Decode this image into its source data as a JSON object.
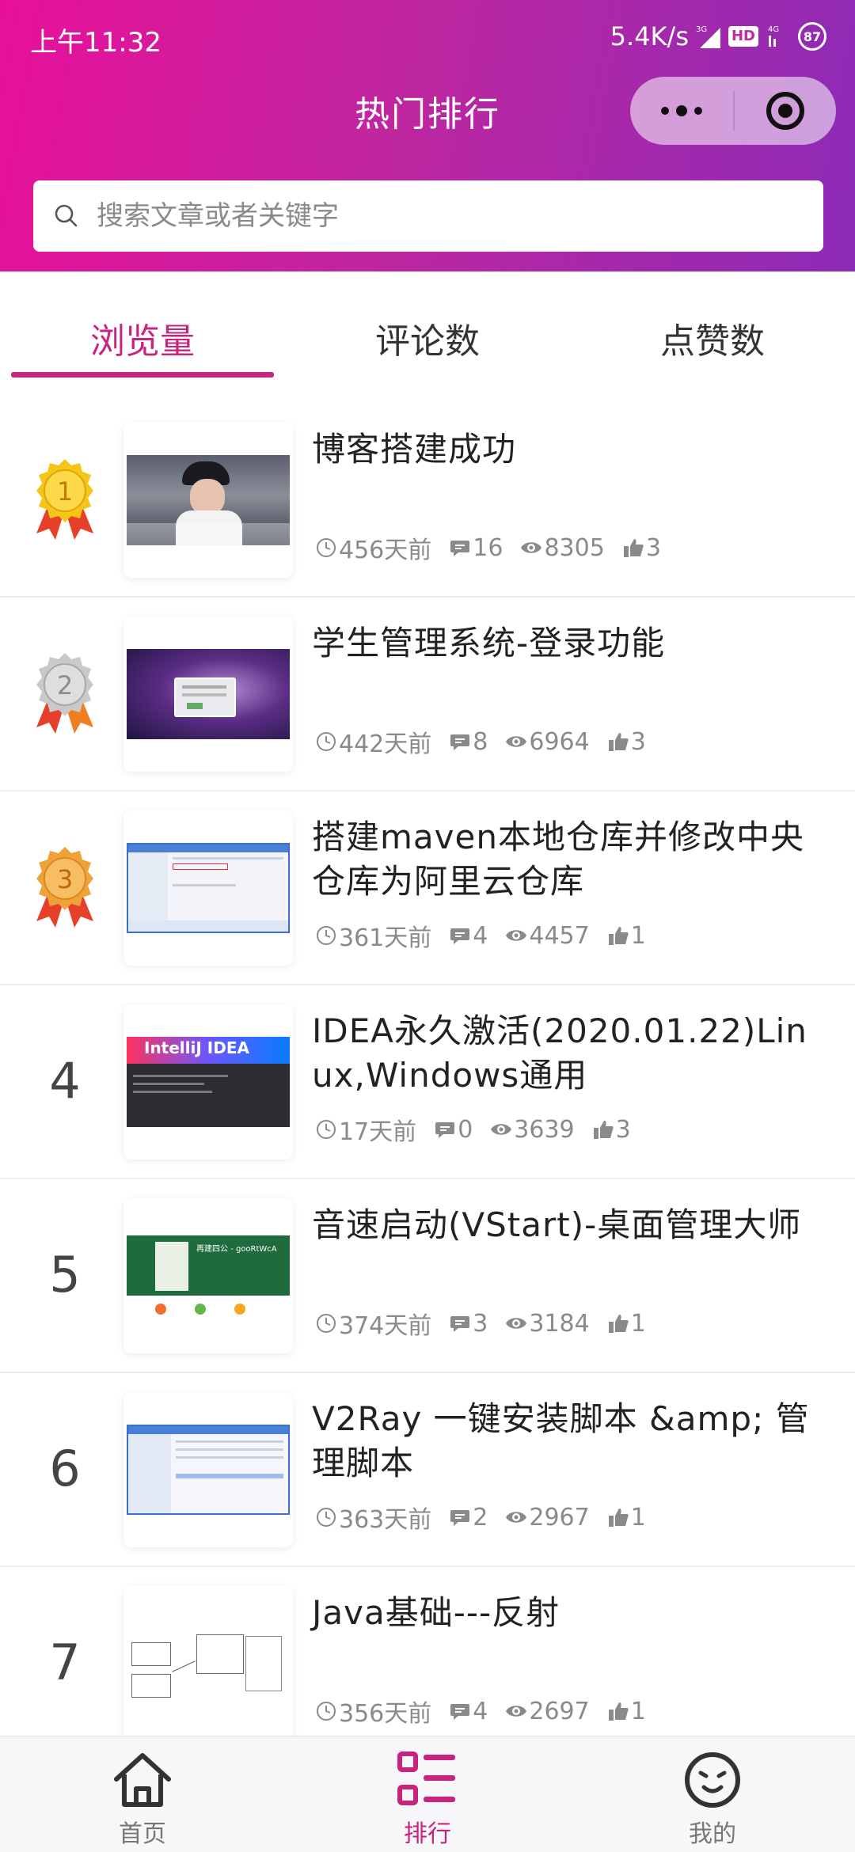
{
  "status": {
    "time": "上午11:32",
    "net_speed": "5.4K/s",
    "signal_label": "3G",
    "hd_label": "HD",
    "net_label": "4G",
    "battery": "87"
  },
  "header": {
    "title": "热门排行",
    "search_placeholder": "搜索文章或者关键字"
  },
  "tabs": [
    {
      "label": "浏览量",
      "active": true
    },
    {
      "label": "评论数",
      "active": false
    },
    {
      "label": "点赞数",
      "active": false
    }
  ],
  "articles": [
    {
      "rank": "1",
      "title": "博客搭建成功",
      "time": "456天前",
      "comments": "16",
      "views": "8305",
      "likes": "3"
    },
    {
      "rank": "2",
      "title": "学生管理系统-登录功能",
      "time": "442天前",
      "comments": "8",
      "views": "6964",
      "likes": "3"
    },
    {
      "rank": "3",
      "title": "搭建maven本地仓库并修改中央仓库为阿里云仓库",
      "time": "361天前",
      "comments": "4",
      "views": "4457",
      "likes": "1"
    },
    {
      "rank": "4",
      "title": "IDEA永久激活(2020.01.22)Linux,Windows通用",
      "time": "17天前",
      "comments": "0",
      "views": "3639",
      "likes": "3"
    },
    {
      "rank": "5",
      "title": "音速启动(VStart)-桌面管理大师",
      "time": "374天前",
      "comments": "3",
      "views": "3184",
      "likes": "1"
    },
    {
      "rank": "6",
      "title": "V2Ray 一键安装脚本 &amp; 管理脚本",
      "time": "363天前",
      "comments": "2",
      "views": "2967",
      "likes": "1"
    },
    {
      "rank": "7",
      "title": "Java基础---反射",
      "time": "356天前",
      "comments": "4",
      "views": "2697",
      "likes": "1"
    }
  ],
  "thumb_text": {
    "idea": "IntelliJ IDEA",
    "vstart": "再建四公 - gooRtWcA"
  },
  "bottom_nav": [
    {
      "label": "首页",
      "icon": "home-icon",
      "active": false
    },
    {
      "label": "排行",
      "icon": "list-icon",
      "active": true
    },
    {
      "label": "我的",
      "icon": "profile-face-icon",
      "active": false
    }
  ],
  "colors": {
    "accent": "#c8237f",
    "gradient_start": "#e8109a",
    "gradient_end": "#8c2bb6",
    "gold": "#f5c518",
    "silver": "#c9c9c9",
    "bronze": "#f0a23a"
  }
}
